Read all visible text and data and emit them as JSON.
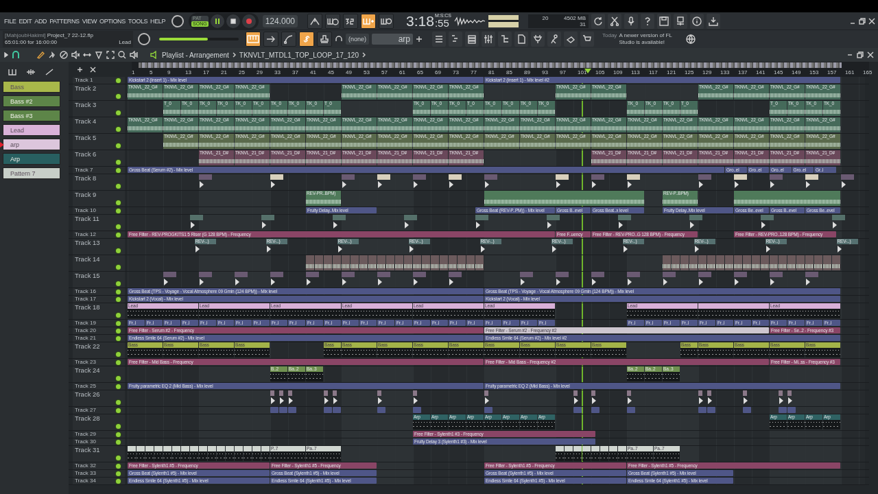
{
  "menu": [
    "FILE",
    "EDIT",
    "ADD",
    "PATTERNS",
    "VIEW",
    "OPTIONS",
    "TOOLS",
    "HELP"
  ],
  "mode_switch": [
    {
      "label": "PAT",
      "selected": false
    },
    {
      "label": "SONG",
      "selected": true
    }
  ],
  "transport": {
    "playing": true,
    "tempo": "124.000"
  },
  "record_toggles": [
    {
      "kind": "arrow-up",
      "on": false
    },
    {
      "kind": "metronome",
      "on": false
    },
    {
      "kind": "countdown",
      "on": false
    },
    {
      "kind": "step-plus",
      "on": true
    },
    {
      "kind": "loop",
      "on": false
    }
  ],
  "time": {
    "main": "3:18",
    "fraction": ":55",
    "format": "M:S:CS"
  },
  "cpu": {
    "polyphony": "20",
    "memory": "4502 MB",
    "cpu": "31"
  },
  "project": {
    "author": "[MahjoubHakimi]",
    "file": "Project_7 22-12.flp",
    "length": "65:01:00 for 16:00:00",
    "hint": "Lead"
  },
  "master_volume": {
    "level": 0.61
  },
  "edit_toggles": [
    {
      "kind": "typing",
      "on": true
    },
    {
      "kind": "arrow",
      "on": false
    },
    {
      "kind": "curve",
      "on": false
    },
    {
      "kind": "link",
      "on": true
    },
    {
      "kind": "stamp",
      "on": false
    }
  ],
  "output": {
    "value": "(none)"
  },
  "pattern_field": {
    "value": "arp"
  },
  "news": {
    "date": "Today",
    "text": "A newer version of FL Studio is available!"
  },
  "playlist": {
    "title": "Playlist - Arrangement",
    "clip_source": "TKNVLT_MTDL1_TOP_LOOP_17_120",
    "playhead": {
      "level": 0.618
    },
    "ruler": [
      "1",
      "5",
      "9",
      "13",
      "17",
      "21",
      "25",
      "29",
      "33",
      "37",
      "41",
      "45",
      "49",
      "53",
      "57",
      "61",
      "65",
      "69",
      "73",
      "77",
      "81",
      "85",
      "89",
      "93",
      "97",
      "101",
      "105",
      "109",
      "113",
      "117",
      "121",
      "125",
      "129",
      "133",
      "137",
      "141",
      "145",
      "149",
      "153",
      "157",
      "161",
      "165"
    ],
    "patterns": [
      {
        "label": "Bass",
        "color": "#a9b84a",
        "selected": false
      },
      {
        "label": "Bass #2",
        "color": "#5d8548",
        "selected": false
      },
      {
        "label": "Bass #3",
        "color": "#5d8548",
        "selected": false
      },
      {
        "label": "Lead",
        "color": "#d9b2d9",
        "selected": false
      },
      {
        "label": "arp",
        "color": "#dcc6dc",
        "selected": true
      },
      {
        "label": "Arp",
        "color": "#285f60",
        "selected": false
      },
      {
        "label": "Pattern 7",
        "color": "#c8cfc8",
        "selected": false
      }
    ],
    "tracks": [
      {
        "name": "Track 1",
        "kind": "automation",
        "color": "#4f5687",
        "clips": [
          {
            "label": "Kickstart 2 (Insert 1) - Mix level"
          },
          {
            "label": "Kickstart 2 (Insert 1) - Mix level #2"
          }
        ]
      },
      {
        "name": "Track 2",
        "kind": "audio",
        "color": "#456a5a",
        "clips": [
          {
            "label": "TKNVL_22_G#"
          },
          {
            "label": "TKNVL_22_G#"
          },
          {
            "label": "TKNVL_22_G#"
          },
          {
            "label": "TKNVL_22_G#"
          },
          {
            "label": "TKNVL_22_G#"
          },
          {
            "label": "TKNVL_22_G#"
          },
          {
            "label": "TKNVL_22_G#"
          },
          {
            "label": "TKNVL_22_G#"
          },
          {
            "label": "TKNVL_22_G#"
          },
          {
            "label": "TKNVL_22_G#"
          },
          {
            "label": "TKNVL_22_G#"
          },
          {
            "label": "TKNVL_22_G#"
          },
          {
            "label": "TKNVL_22_G#"
          },
          {
            "label": "TKNVL_22_G#"
          }
        ]
      },
      {
        "name": "Track 3",
        "kind": "audio",
        "color": "#456a5a",
        "clips": [
          {
            "label": "T_0"
          },
          {
            "label": "TK_0"
          },
          {
            "label": "TK_0"
          },
          {
            "label": "TK_0"
          },
          {
            "label": "TK_0"
          },
          {
            "label": "TK_0"
          },
          {
            "label": "TK_0"
          },
          {
            "label": "TK_0"
          },
          {
            "label": "TK_0"
          },
          {
            "label": "T_0"
          },
          {
            "label": "TK_0"
          },
          {
            "label": "TK_0"
          },
          {
            "label": "TK_0"
          },
          {
            "label": "T_0"
          },
          {
            "label": "TK_0"
          },
          {
            "label": "TK_0"
          },
          {
            "label": "TK_0"
          },
          {
            "label": "TK_0"
          },
          {
            "label": "TK_0"
          },
          {
            "label": "TK_0"
          },
          {
            "label": "TK_0"
          },
          {
            "label": "T_0"
          },
          {
            "label": "T_0"
          },
          {
            "label": "TK_0"
          },
          {
            "label": "TK_0"
          },
          {
            "label": "TK_0"
          }
        ]
      },
      {
        "name": "Track 4",
        "kind": "audio",
        "color": "#456a5a",
        "clips": [
          {
            "label": "TKNVL_22_G#"
          },
          {
            "label": "TKNVL_22_G#"
          },
          {
            "label": "TKNVL_22_G#"
          },
          {
            "label": "TKNVL_22_G#"
          },
          {
            "label": "TKNVL_22_G#"
          },
          {
            "label": "TKNVL_22_G#"
          },
          {
            "label": "TKNVL_22_G#"
          },
          {
            "label": "TKNVL_22_G#"
          },
          {
            "label": "TKNVL_22_G#"
          },
          {
            "label": "TKNVL_22_G#"
          },
          {
            "label": "TKNVL_22_G#"
          },
          {
            "label": "TKNVL_22_G#"
          },
          {
            "label": "TKNVL_22_G#"
          },
          {
            "label": "TKNVL_22_G#"
          },
          {
            "label": "TKNVL_22_G#"
          },
          {
            "label": "TKNVL_22_G#"
          },
          {
            "label": "TKNVL_22_G#"
          },
          {
            "label": "TKNVL_22_G#"
          },
          {
            "label": "TKNVL_22_G#"
          },
          {
            "label": "TKNVL_22_G#"
          }
        ]
      },
      {
        "name": "Track 5",
        "kind": "audio",
        "color": "#5a6a4c",
        "clips": [
          {
            "label": "TKNVL_22_G#"
          },
          {
            "label": "TKNVL_22_G#"
          },
          {
            "label": "TKNVL_22_G#"
          },
          {
            "label": "TKNVL_22_G#"
          },
          {
            "label": "TKNVL_22_G#"
          },
          {
            "label": "TKNVL_22_G#"
          },
          {
            "label": "TKNVL_22_G#"
          },
          {
            "label": "TKNVL_22_G#"
          },
          {
            "label": "TKNVL_22_G#"
          },
          {
            "label": "TKNVL_22_G#"
          },
          {
            "label": "TKNVL_22_G#"
          },
          {
            "label": "TKNVL_22_G#"
          },
          {
            "label": "TKNVL_22_G#"
          },
          {
            "label": "TKNVL_22_G#"
          },
          {
            "label": "TKNVL_22_G#"
          },
          {
            "label": "TKNVL_22_G#"
          },
          {
            "label": "TKNVL_22_G#"
          },
          {
            "label": "TKNVL_22_G#"
          },
          {
            "label": "TKNVL_22_G#"
          }
        ]
      },
      {
        "name": "Track 6",
        "kind": "audio",
        "color": "#6a485a",
        "clips": [
          {
            "label": "TKNVL_21_D#"
          },
          {
            "label": "TKNVL_21_D#"
          },
          {
            "label": "TKNVL_21_D#"
          },
          {
            "label": "TKNVL_21_D#"
          },
          {
            "label": "TKNVL_21_D#"
          },
          {
            "label": "TKNVL_21_D#"
          },
          {
            "label": "TKNVL_21_D#"
          },
          {
            "label": "TKNVL_21_D#"
          },
          {
            "label": "TKNVL_21_D#"
          },
          {
            "label": "TKNVL_21_D#"
          },
          {
            "label": "TKNVL_21_D#"
          },
          {
            "label": "TKNVL_21_D#"
          },
          {
            "label": "TKNVL_21_D#"
          },
          {
            "label": "TKNVL_21_D#"
          },
          {
            "label": "TKNVL_21_D#"
          }
        ]
      },
      {
        "name": "Track 7",
        "kind": "automation",
        "color": "#4f5687",
        "clips": [
          {
            "label": "Gross Beat (Serum #2) - Mix level"
          },
          {
            "label": "Gro..el"
          },
          {
            "label": "Gro..el"
          },
          {
            "label": "Gro..el"
          },
          {
            "label": "Gro..el"
          },
          {
            "label": "Gr..l"
          }
        ]
      },
      {
        "name": "Track 8",
        "kind": "sample",
        "color": "#6a5a72"
      },
      {
        "name": "Track 9",
        "kind": "audio",
        "color": "#4f7a5a",
        "clips": [
          {
            "label": "REV-PR..BPM)"
          },
          {
            "label": "REV-P..BPM)"
          }
        ]
      },
      {
        "name": "Track 10",
        "kind": "automation",
        "color": "#4f5687",
        "clips": [
          {
            "label": "Fruity Delay..Mix level"
          },
          {
            "label": "Gross Beat (REV-P..PM)) - Mix level"
          },
          {
            "label": "Gross B..evel"
          },
          {
            "label": "Gross Beat..x level"
          },
          {
            "label": "Fruity Delay..Mix level"
          },
          {
            "label": "Gross Be..evel"
          },
          {
            "label": "Gross B..evel"
          },
          {
            "label": "Gross Be..evel"
          }
        ]
      },
      {
        "name": "Track 11",
        "kind": "sample",
        "color": "#55706a"
      },
      {
        "name": "Track 12",
        "kind": "automation",
        "color": "#8a4566",
        "clips": [
          {
            "label": "Free Filter - REV-PROGKITS1 5 Riser (G 128 BPM) - Frequency"
          },
          {
            "label": "Free F..uency"
          },
          {
            "label": "Free Filter - REV-PRO..G 128 BPM) - Frequency"
          },
          {
            "label": "Free Filter - REV-PRO..128 BPM) - Frequency"
          }
        ]
      },
      {
        "name": "Track 13",
        "kind": "sample",
        "color": "#557070",
        "clips": [
          {
            "label": "REV-..)"
          },
          {
            "label": "REV-..)"
          },
          {
            "label": "REV-..)"
          },
          {
            "label": "REV-..)"
          },
          {
            "label": "REV-..)"
          },
          {
            "label": "REV-..)"
          },
          {
            "label": "REV-..)"
          },
          {
            "label": "REV-..)"
          },
          {
            "label": "REV-..)"
          },
          {
            "label": "REV-..)"
          }
        ]
      },
      {
        "name": "Track 14",
        "kind": "audio",
        "color": "#6b5a5c"
      },
      {
        "name": "Track 15",
        "kind": "sample",
        "color": "#6a5a72"
      },
      {
        "name": "Track 16",
        "kind": "automation",
        "color": "#4f5687",
        "clips": [
          {
            "label": "Gross Beat (TPS - Voyage - Vocal Atmosphere 09 Gmin (124 BPM)) - Mix level"
          },
          {
            "label": "Gross Beat (TPS - Voyage - Vocal Atmosphere 09 Gmin (124 BPM)) - Mix level"
          }
        ]
      },
      {
        "name": "Track 17",
        "kind": "automation",
        "color": "#4f5687",
        "clips": [
          {
            "label": "Kickstart 2 (Vocal) - Mix level"
          },
          {
            "label": "Kickstart 2 (Vocal) - Mix level"
          }
        ]
      },
      {
        "name": "Track 18",
        "kind": "pattern",
        "color": "#d8b0d8",
        "clips": [
          {
            "label": "Lead"
          },
          {
            "label": "Lead"
          },
          {
            "label": "Lead"
          },
          {
            "label": "Lead"
          },
          {
            "label": "Lead"
          },
          {
            "label": "Lead"
          },
          {
            "label": "Lead"
          },
          {
            "label": "Lead"
          }
        ]
      },
      {
        "name": "Track 19",
        "kind": "automation",
        "color": "#4f5687",
        "clips": [
          {
            "label": "Fr..l"
          },
          {
            "label": "Fr..l"
          },
          {
            "label": "Fr..l"
          },
          {
            "label": "Fr..l"
          },
          {
            "label": "Fr..l"
          },
          {
            "label": "Fr..l"
          },
          {
            "label": "Fr..l"
          },
          {
            "label": "Fr..l"
          },
          {
            "label": "Fr..l"
          },
          {
            "label": "Fr..l"
          },
          {
            "label": "Fr..l"
          },
          {
            "label": "Fr..l"
          },
          {
            "label": "Fr..l"
          },
          {
            "label": "Fr..l"
          },
          {
            "label": "Fr..l"
          },
          {
            "label": "Fr..l"
          },
          {
            "label": "Fr..l"
          },
          {
            "label": "Fr..l"
          },
          {
            "label": "Fr..l"
          },
          {
            "label": "Fr..l"
          },
          {
            "label": "Fr..l"
          },
          {
            "label": "Fr..l"
          },
          {
            "label": "Fr..l"
          },
          {
            "label": "Fr..l"
          },
          {
            "label": "Fr..l"
          },
          {
            "label": "Fr..l"
          },
          {
            "label": "Fr..l"
          },
          {
            "label": "Fr..l"
          },
          {
            "label": "Fr..l"
          },
          {
            "label": "Fr..l"
          },
          {
            "label": "Fr..l"
          },
          {
            "label": "Fr..l"
          },
          {
            "label": "Fr..l"
          },
          {
            "label": "Fr..l"
          },
          {
            "label": "Fr..l"
          },
          {
            "label": "Fr..l"
          }
        ]
      },
      {
        "name": "Track 20",
        "kind": "automation",
        "clips": [
          {
            "label": "Free Filter - Serum #2 - Frequency",
            "color": "#8a4566"
          },
          {
            "label": "Free Filter - Serum #2 - Frequency #2",
            "color": "#cdc6cf"
          },
          {
            "label": "Free Filter - Se..2 - Frequency #3",
            "color": "#8a4566"
          }
        ]
      },
      {
        "name": "Track 21",
        "kind": "automation",
        "color": "#4f5687",
        "clips": [
          {
            "label": "Endless Smile 64 (Serum #2) - Mix level"
          },
          {
            "label": "Endless Smile 64 (Serum #2) - Mix level #2"
          }
        ]
      },
      {
        "name": "Track 22",
        "kind": "pattern",
        "color": "#a3b348",
        "clips": [
          {
            "label": "Bass"
          },
          {
            "label": "Bass"
          },
          {
            "label": "Bass"
          },
          {
            "label": "Bass"
          },
          {
            "label": "Bass"
          },
          {
            "label": "Bass"
          },
          {
            "label": "Bass"
          },
          {
            "label": "Bass"
          },
          {
            "label": "Bass"
          },
          {
            "label": "Bass"
          },
          {
            "label": "Bass"
          },
          {
            "label": "Bass"
          },
          {
            "label": "Bass"
          },
          {
            "label": "Bass"
          },
          {
            "label": "Bass"
          },
          {
            "label": "Bass"
          },
          {
            "label": "Bass"
          },
          {
            "label": "Bass"
          }
        ]
      },
      {
        "name": "Track 23",
        "kind": "automation",
        "color": "#8a4566",
        "clips": [
          {
            "label": "Free Filter - Mid Bass - Frequency"
          },
          {
            "label": "Free Filter - Mid Bass - Frequency #2"
          },
          {
            "label": "Free Filter - Mi..ss - Frequency #3"
          }
        ]
      },
      {
        "name": "Track 24",
        "kind": "pattern",
        "color": "#6f9150",
        "clips": [
          {
            "label": "B..2"
          },
          {
            "label": "Ba..2"
          },
          {
            "label": "Ba..3"
          },
          {
            "label": "Ba..2"
          },
          {
            "label": "Ba..2"
          },
          {
            "label": "Ba..3"
          }
        ]
      },
      {
        "name": "Track 25",
        "kind": "automation",
        "color": "#4f5687",
        "clips": [
          {
            "label": "Fruity parametric EQ 2 (Mid Bass) - Mix level"
          },
          {
            "label": "Fruity parametric EQ 2 (Mid Bass) - Mix level"
          }
        ]
      },
      {
        "name": "Track 26",
        "kind": "sample",
        "color": "#8a7888"
      },
      {
        "name": "Track 27",
        "kind": "automation",
        "color": "#4f5687"
      },
      {
        "name": "Track 28",
        "kind": "pattern",
        "color": "#2f6263",
        "clips": [
          {
            "label": "Arp"
          },
          {
            "label": "Arp"
          },
          {
            "label": "Arp"
          },
          {
            "label": "Arp"
          },
          {
            "label": "Arp"
          },
          {
            "label": "Arp"
          },
          {
            "label": "Arp"
          },
          {
            "label": "Arp"
          },
          {
            "label": "Arp"
          },
          {
            "label": "Arp"
          },
          {
            "label": "Arp"
          },
          {
            "label": "Arp"
          }
        ]
      },
      {
        "name": "Track 29",
        "kind": "automation",
        "color": "#8a4566",
        "clips": [
          {
            "label": "Free Filter - Sylenth1 #3 - Frequency"
          }
        ]
      },
      {
        "name": "Track 30",
        "kind": "automation",
        "color": "#4f5687",
        "clips": [
          {
            "label": "Fruity Delay 3 (Sylenth1 #3) - Mix level"
          }
        ]
      },
      {
        "name": "Track 31",
        "kind": "pattern",
        "color": "#d0d6d0",
        "clips": [
          {
            "label": "P..7"
          },
          {
            "label": "Pa..7"
          },
          {
            "label": "Pa..7"
          },
          {
            "label": "Pa..7"
          }
        ]
      },
      {
        "name": "Track 32",
        "kind": "automation",
        "color": "#8a4566",
        "clips": [
          {
            "label": "Free Filter - Sylenth1 #5 - Frequency"
          },
          {
            "label": "Free Filter - Sylenth1 #5 - Frequency"
          },
          {
            "label": "Free Filter - Sylenth1 #5 - Frequency"
          },
          {
            "label": "Free Filter - Sylenth1 #5 - Frequency"
          }
        ]
      },
      {
        "name": "Track 33",
        "kind": "automation",
        "color": "#4f5687",
        "clips": [
          {
            "label": "Gross Beat (Sylenth1 #5) - Mix level"
          },
          {
            "label": "Gross Beat (Sylenth1 #5) - Mix level"
          },
          {
            "label": "Gross Beat (Sylenth1 #5) - Mix level"
          },
          {
            "label": "Gross Beat (Sylenth1 #5) - Mix level"
          }
        ]
      },
      {
        "name": "Track 34",
        "kind": "automation",
        "color": "#4f5687",
        "clips": [
          {
            "label": "Endless Smile 64 (Sylenth1 #5) - Mix level"
          },
          {
            "label": "Endless Smile 64 (Sylenth1 #5) - Mix level"
          },
          {
            "label": "Endless Smile 64 (Sylenth1 #5) - Mix level"
          },
          {
            "label": "Endless Smile 64 (Sylenth1 #5) - Mix level"
          }
        ]
      }
    ]
  }
}
